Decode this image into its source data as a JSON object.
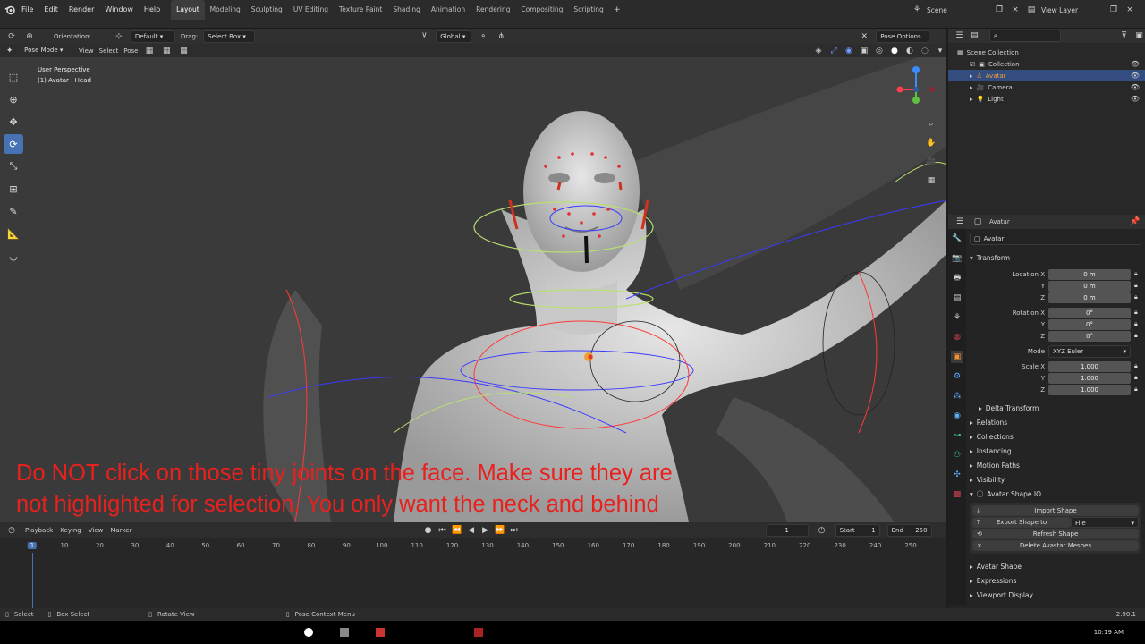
{
  "menu": {
    "file": "File",
    "edit": "Edit",
    "render": "Render",
    "window": "Window",
    "help": "Help"
  },
  "workspaces": [
    "Layout",
    "Modeling",
    "Sculpting",
    "UV Editing",
    "Texture Paint",
    "Shading",
    "Animation",
    "Rendering",
    "Compositing",
    "Scripting"
  ],
  "active_workspace": "Layout",
  "scene_label": "Scene",
  "view_layer_label": "View Layer",
  "toolbar": {
    "orientation_label": "Orientation:",
    "orientation_value": "Default",
    "drag_label": "Drag:",
    "drag_value": "Select Box",
    "transform_value": "Global",
    "pose_options": "Pose Options"
  },
  "viewport_header": {
    "mode": "Pose Mode",
    "view": "View",
    "select": "Select",
    "pose": "Pose"
  },
  "viewport_info": {
    "line1": "User Perspective",
    "line2": "(1) Avatar : Head"
  },
  "annotation": "Do NOT click on those tiny joints on the face. Make sure they are not highlighted for selection. You only want the neck and behind the head joint selected along with the rest of body joints.",
  "outliner": {
    "scene_collection": "Scene Collection",
    "collection": "Collection",
    "items": [
      {
        "name": "Avatar",
        "selected": true
      },
      {
        "name": "Camera",
        "selected": false
      },
      {
        "name": "Light",
        "selected": false
      }
    ]
  },
  "properties": {
    "object_name_header": "Avatar",
    "object_name_field": "Avatar",
    "transform_title": "Transform",
    "location": {
      "label_x": "Location X",
      "label_y": "Y",
      "label_z": "Z",
      "x": "0 m",
      "y": "0 m",
      "z": "0 m"
    },
    "rotation": {
      "label_x": "Rotation X",
      "label_y": "Y",
      "label_z": "Z",
      "x": "0°",
      "y": "0°",
      "z": "0°"
    },
    "mode_label": "Mode",
    "mode_value": "XYZ Euler",
    "scale": {
      "label_x": "Scale X",
      "label_y": "Y",
      "label_z": "Z",
      "x": "1.000",
      "y": "1.000",
      "z": "1.000"
    },
    "delta_transform": "Delta Transform",
    "sections": [
      "Relations",
      "Collections",
      "Instancing",
      "Motion Paths",
      "Visibility"
    ],
    "avatar_shape_io": "Avatar Shape IO",
    "import_shape": "Import Shape",
    "export_shape_label": "Export Shape to",
    "export_shape_value": "File",
    "refresh_shape": "Refresh Shape",
    "delete_meshes": "Delete Avastar Meshes",
    "after_sections": [
      "Avatar Shape",
      "Expressions",
      "Viewport Display"
    ]
  },
  "timeline": {
    "playback": "Playback",
    "keying": "Keying",
    "view": "View",
    "marker": "Marker",
    "current_frame": "1",
    "start_label": "Start",
    "start": "1",
    "end_label": "End",
    "end": "250",
    "ruler": [
      "1",
      "10",
      "20",
      "30",
      "40",
      "50",
      "60",
      "70",
      "80",
      "90",
      "100",
      "110",
      "120",
      "130",
      "140",
      "150",
      "160",
      "170",
      "180",
      "190",
      "200",
      "210",
      "220",
      "230",
      "240",
      "250"
    ]
  },
  "statusbar": {
    "select": "Select",
    "box_select": "Box Select",
    "rotate_view": "Rotate View",
    "pose_context_menu": "Pose Context Menu",
    "version": "2.90.1"
  },
  "clock": "10:19 AM",
  "colors": {
    "accent": "#4772b3",
    "annotation": "#e8211e",
    "selected_row": "#334d80"
  }
}
